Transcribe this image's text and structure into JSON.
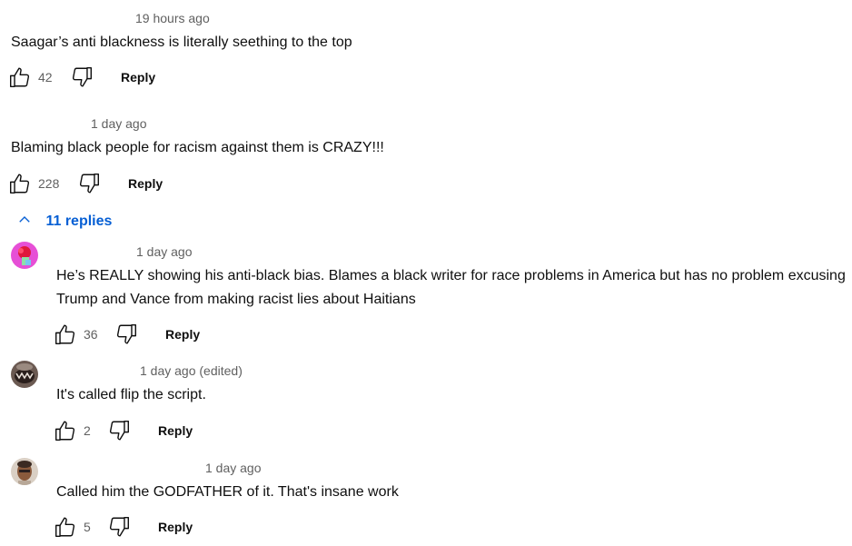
{
  "colors": {
    "link": "#065fd4",
    "meta_text": "#606060",
    "body_text": "#0f0f0f"
  },
  "comments": [
    {
      "time": "19 hours ago",
      "text": "Saagar’s anti blackness is literally seething to the top",
      "likes": "42",
      "reply_label": "Reply"
    },
    {
      "time": "1 day ago",
      "text": "Blaming black people for racism against them is CRAZY!!!",
      "likes": "228",
      "reply_label": "Reply",
      "replies_toggle": "11 replies",
      "replies": [
        {
          "time": "1 day ago",
          "text": "He’s REALLY showing his anti-black bias. Blames a black writer for race problems in America but has no problem excusing Trump and Vance from making racist lies about Haitians",
          "likes": "36",
          "reply_label": "Reply",
          "avatar_icon": "pink-flower-avatar"
        },
        {
          "time": "1 day ago (edited)",
          "text": "It's called flip the script.",
          "likes": "2",
          "reply_label": "Reply",
          "avatar_icon": "dark-photo-avatar"
        },
        {
          "time": "1 day ago",
          "text": "Called him the GODFATHER of it. That's insane work",
          "likes": "5",
          "reply_label": "Reply",
          "avatar_icon": "portrait-avatar"
        }
      ]
    }
  ]
}
